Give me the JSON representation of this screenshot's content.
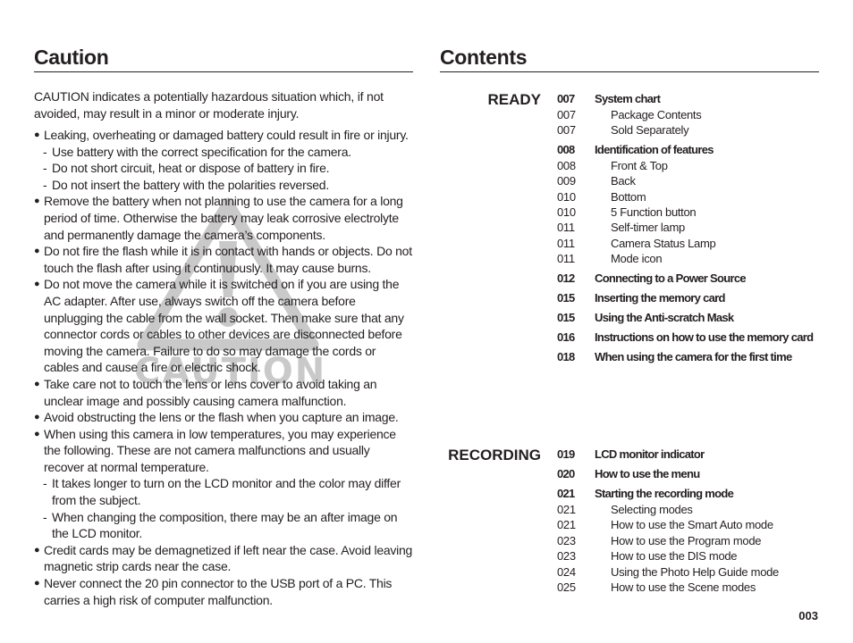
{
  "caution": {
    "title": "Caution",
    "intro": "CAUTION indicates a potentially hazardous situation which, if not avoided, may result in a minor or moderate injury.",
    "watermark_text": "CAUTION",
    "bullets": [
      {
        "text": "Leaking, overheating or damaged battery could result in fire or injury.",
        "subs": [
          "Use battery with the correct specification for the camera.",
          "Do not short circuit, heat or dispose of battery in fire.",
          "Do not insert the battery with the polarities reversed."
        ]
      },
      {
        "text": "Remove the battery when not planning to use the camera for a long period of time. Otherwise the battery may leak corrosive electrolyte and permanently damage the camera’s components.",
        "subs": []
      },
      {
        "text": "Do not fire the flash while it is in contact with hands or objects. Do not touch the flash after using it continuously. It may cause burns.",
        "subs": []
      },
      {
        "text": "Do not move the camera while it is switched on if you are using the AC adapter. After use, always switch off the camera before unplugging the cable from the wall socket. Then make sure that any connector cords or cables to other devices are disconnected before moving the camera. Failure to do so may damage the cords or cables and cause a fire or electric shock.",
        "subs": []
      },
      {
        "text": "Take care not to touch the lens or lens cover to avoid taking an unclear image and possibly causing camera malfunction.",
        "subs": []
      },
      {
        "text": "Avoid obstructing the lens or the flash when you capture an image.",
        "subs": []
      },
      {
        "text": "When using this camera in low temperatures, you may experience the following. These are not camera malfunctions and usually recover at normal temperature.",
        "subs": [
          "It takes longer to turn on the LCD monitor and the color may differ from the subject.",
          "When changing the composition, there may be an after image on the LCD monitor."
        ]
      },
      {
        "text": "Credit cards may be demagnetized if left near the case. Avoid leaving magnetic strip cards near the case.",
        "subs": []
      },
      {
        "text": "Never connect the 20 pin connector to the USB port of a PC. This carries a high risk of computer malfunction.",
        "subs": []
      }
    ]
  },
  "contents": {
    "title": "Contents",
    "sections": [
      {
        "label": "READY",
        "entries": [
          {
            "page": "007",
            "title": "System chart",
            "level": "main"
          },
          {
            "page": "007",
            "title": "Package Contents",
            "level": "sub"
          },
          {
            "page": "007",
            "title": "Sold Separately",
            "level": "sub"
          },
          {
            "page": "008",
            "title": "Identification of features",
            "level": "main"
          },
          {
            "page": "008",
            "title": "Front & Top",
            "level": "sub"
          },
          {
            "page": "009",
            "title": "Back",
            "level": "sub"
          },
          {
            "page": "010",
            "title": "Bottom",
            "level": "sub"
          },
          {
            "page": "010",
            "title": "5 Function button",
            "level": "sub"
          },
          {
            "page": "011",
            "title": "Self-timer lamp",
            "level": "sub"
          },
          {
            "page": "011",
            "title": "Camera Status Lamp",
            "level": "sub"
          },
          {
            "page": "011",
            "title": "Mode icon",
            "level": "sub"
          },
          {
            "page": "012",
            "title": "Connecting to a Power Source",
            "level": "main"
          },
          {
            "page": "015",
            "title": "Inserting the memory card",
            "level": "main"
          },
          {
            "page": "015",
            "title": "Using the Anti-scratch Mask",
            "level": "main"
          },
          {
            "page": "016",
            "title": "Instructions on how to use the memory card",
            "level": "main"
          },
          {
            "page": "018",
            "title": "When using the camera for the first time",
            "level": "main"
          }
        ]
      },
      {
        "label": "RECORDING",
        "entries": [
          {
            "page": "019",
            "title": "LCD monitor indicator",
            "level": "main"
          },
          {
            "page": "020",
            "title": "How to use the menu",
            "level": "main"
          },
          {
            "page": "021",
            "title": "Starting the recording mode",
            "level": "main"
          },
          {
            "page": "021",
            "title": "Selecting modes",
            "level": "sub"
          },
          {
            "page": "021",
            "title": "How to use the Smart Auto mode",
            "level": "sub"
          },
          {
            "page": "023",
            "title": "How to use the Program mode",
            "level": "sub"
          },
          {
            "page": "023",
            "title": "How to use the DIS mode",
            "level": "sub"
          },
          {
            "page": "024",
            "title": "Using the Photo Help Guide mode",
            "level": "sub"
          },
          {
            "page": "025",
            "title": "How to use the Scene modes",
            "level": "sub"
          }
        ]
      }
    ]
  },
  "footer": {
    "page_number": "003"
  },
  "colors": {
    "text": "#231f20",
    "watermark": "#c9c9c9"
  }
}
